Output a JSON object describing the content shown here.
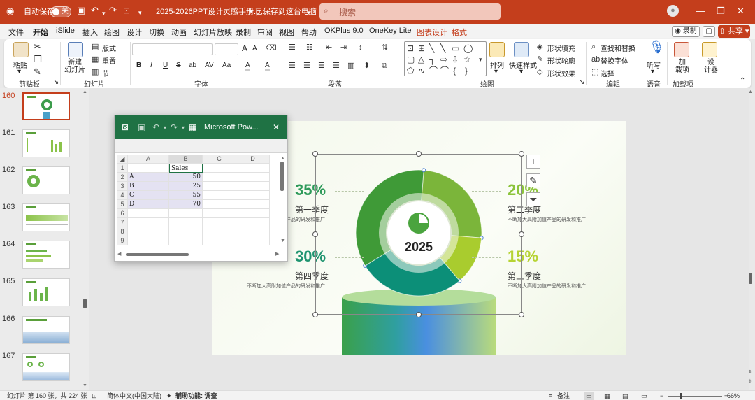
{
  "titlebar": {
    "autosave_label": "自动保存",
    "autosave_state": "关",
    "filename": "2025-2026PPT设计灵感手册.p...",
    "save_status": "• 已保存到这台电脑",
    "search_placeholder": "搜索",
    "accent_color": "#c43e1c"
  },
  "menu": {
    "tabs": [
      "文件",
      "开始",
      "iSlide",
      "插入",
      "绘图",
      "设计",
      "切换",
      "动画",
      "幻灯片放映",
      "录制",
      "审阅",
      "视图",
      "帮助",
      "OKPlus 9.0",
      "OneKey Lite",
      "图表设计",
      "格式"
    ],
    "active_tab": "开始",
    "record_label": "录制",
    "share_label": "共享"
  },
  "ribbon": {
    "clipboard": {
      "label": "剪贴板",
      "paste": "粘贴"
    },
    "slides": {
      "label": "幻灯片",
      "new_slide": "新建\n幻灯片",
      "layout": "版式",
      "reset": "重置",
      "section": "节"
    },
    "font": {
      "label": "字体",
      "buttons": [
        "B",
        "I",
        "U",
        "S",
        "ab",
        "AV",
        "Aa",
        "A",
        "A"
      ]
    },
    "paragraph": {
      "label": "段落"
    },
    "drawing": {
      "label": "绘图",
      "arrange": "排列",
      "quick_styles": "快速样式",
      "shape_fill": "形状填充",
      "shape_outline": "形状轮廓",
      "shape_effects": "形状效果"
    },
    "editing": {
      "label": "编辑",
      "find_replace": "查找和替换",
      "replace_font": "替换字体",
      "select": "选择"
    },
    "voice": {
      "label": "语音",
      "dictate": "听写"
    },
    "addins": {
      "label": "加载项",
      "addins": "加\n载项",
      "designer": "设\n计器"
    }
  },
  "slides": [
    {
      "num": "160",
      "active": true
    },
    {
      "num": "161",
      "active": false
    },
    {
      "num": "162",
      "active": false
    },
    {
      "num": "163",
      "active": false
    },
    {
      "num": "164",
      "active": false
    },
    {
      "num": "165",
      "active": false
    },
    {
      "num": "166",
      "active": false
    },
    {
      "num": "167",
      "active": false
    }
  ],
  "slide_content": {
    "center_year": "2025",
    "quarters": [
      {
        "pct": "35%",
        "title": "第一季度",
        "desc": "不断加大高附加值产品的研发和推广",
        "color": "#2e9a5a"
      },
      {
        "pct": "20%",
        "title": "第二季度",
        "desc": "不断加大高附加值产品的研发和推广",
        "color": "#8cc43c"
      },
      {
        "pct": "30%",
        "title": "第四季度",
        "desc": "不断加大高附加值产品的研发和推广",
        "color": "#1f9470"
      },
      {
        "pct": "15%",
        "title": "第三季度",
        "desc": "不断加大高附加值产品的研发和推广",
        "color": "#b6d332"
      }
    ]
  },
  "chart_data": {
    "type": "pie",
    "title": "",
    "categories": [
      "A",
      "B",
      "C",
      "D"
    ],
    "series": [
      {
        "name": "Sales",
        "values": [
          50,
          25,
          55,
          70
        ]
      }
    ]
  },
  "excel": {
    "title": "Microsoft Pow...",
    "columns": [
      "A",
      "B",
      "C",
      "D"
    ],
    "rows": [
      {
        "n": "1",
        "a": "",
        "b": "Sales"
      },
      {
        "n": "2",
        "a": "A",
        "b": "50"
      },
      {
        "n": "3",
        "a": "B",
        "b": "25"
      },
      {
        "n": "4",
        "a": "C",
        "b": "55"
      },
      {
        "n": "5",
        "a": "D",
        "b": "70"
      },
      {
        "n": "6",
        "a": "",
        "b": ""
      },
      {
        "n": "7",
        "a": "",
        "b": ""
      },
      {
        "n": "8",
        "a": "",
        "b": ""
      },
      {
        "n": "9",
        "a": "",
        "b": ""
      }
    ]
  },
  "statusbar": {
    "slide_info": "幻灯片 第 160 张，共 224 张",
    "language": "简体中文(中国大陆)",
    "accessibility": "辅助功能: 调查",
    "notes": "备注",
    "zoom": "66%"
  }
}
